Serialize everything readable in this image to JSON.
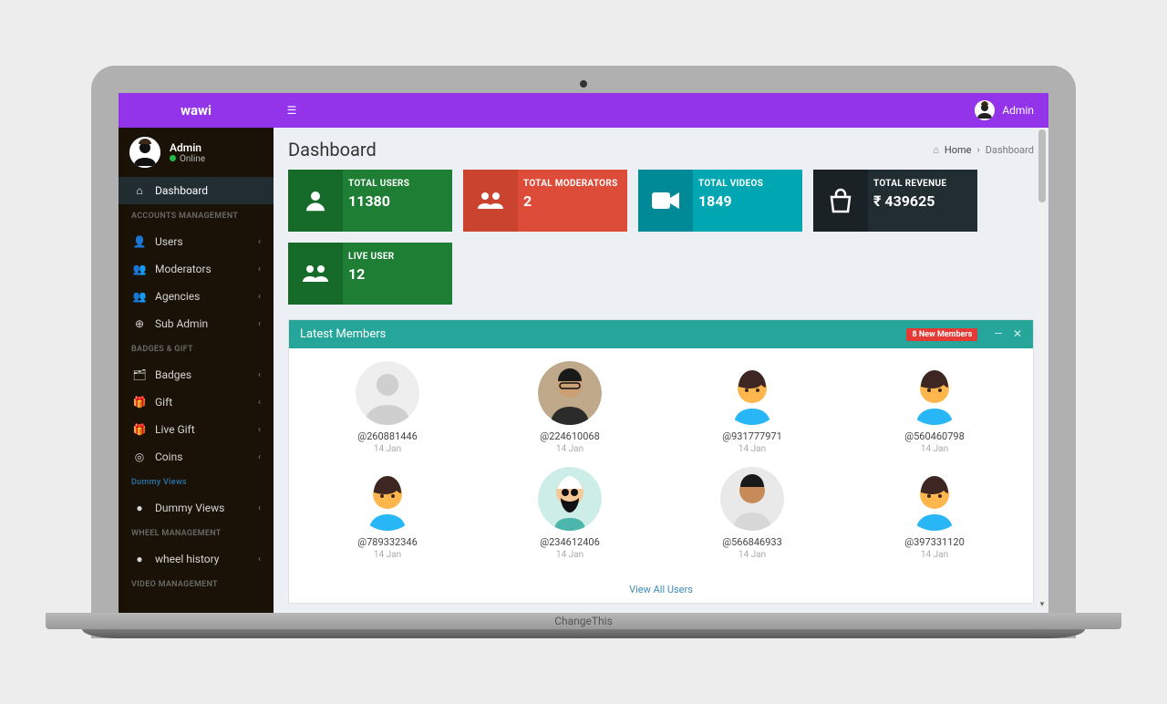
{
  "brand": "wawi",
  "topbar": {
    "user_name": "Admin"
  },
  "side_user": {
    "name": "Admin",
    "status": "Online"
  },
  "nav": {
    "dashboard": "Dashboard",
    "section_accounts": "ACCOUNTS MANAGEMENT",
    "users": "Users",
    "moderators": "Moderators",
    "agencies": "Agencies",
    "sub_admin": "Sub Admin",
    "section_badges": "BADGES & GIFT",
    "badges": "Badges",
    "gift": "Gift",
    "live_gift": "Live Gift",
    "coins": "Coins",
    "section_dummy": "Dummy Views",
    "dummy_views": "Dummy Views",
    "section_wheel": "WHEEL MANAGEMENT",
    "wheel_history": "wheel history",
    "section_video": "VIDEO MANAGEMENT"
  },
  "page": {
    "title": "Dashboard",
    "crumb_home": "Home",
    "crumb_current": "Dashboard"
  },
  "stats": {
    "total_users": {
      "label": "TOTAL USERS",
      "value": "11380",
      "bg": "#1e7e34",
      "icon_bg": "#166b2b"
    },
    "total_moderators": {
      "label": "TOTAL MODERATORS",
      "value": "2",
      "bg": "#dd4b39",
      "icon_bg": "#c9432f"
    },
    "total_videos": {
      "label": "TOTAL VIDEOS",
      "value": "1849",
      "bg": "#00a7b3",
      "icon_bg": "#008a97"
    },
    "total_revenue": {
      "label": "TOTAL REVENUE",
      "value": "₹ 439625",
      "bg": "#222d32",
      "icon_bg": "#1a2226"
    },
    "live_user": {
      "label": "LIVE USER",
      "value": "12",
      "bg": "#1e7e34",
      "icon_bg": "#166b2b"
    }
  },
  "members_panel": {
    "title": "Latest Members",
    "badge": "8 New Members",
    "view_all": "View All Users",
    "list": [
      {
        "handle": "@260881446",
        "date": "14 Jan",
        "type": "placeholder"
      },
      {
        "handle": "@224610068",
        "date": "14 Jan",
        "type": "photo1"
      },
      {
        "handle": "@931777971",
        "date": "14 Jan",
        "type": "cartoon"
      },
      {
        "handle": "@560460798",
        "date": "14 Jan",
        "type": "cartoon"
      },
      {
        "handle": "@789332346",
        "date": "14 Jan",
        "type": "cartoon"
      },
      {
        "handle": "@234612406",
        "date": "14 Jan",
        "type": "bearded"
      },
      {
        "handle": "@566846933",
        "date": "14 Jan",
        "type": "photo2"
      },
      {
        "handle": "@397331120",
        "date": "14 Jan",
        "type": "cartoon"
      }
    ]
  },
  "laptop_label": "ChangeThis"
}
